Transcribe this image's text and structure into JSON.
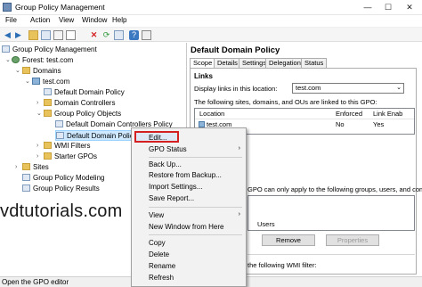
{
  "window": {
    "title": "Group Policy Management",
    "minimize": "—",
    "maximize": "☐",
    "close": "✕"
  },
  "menu": [
    "File",
    "Action",
    "View",
    "Window",
    "Help"
  ],
  "tree": {
    "root": "Group Policy Management",
    "forest": "Forest: test.com",
    "domains": "Domains",
    "domain": "test.com",
    "default_domain_policy": "Default Domain Policy",
    "domain_controllers": "Domain Controllers",
    "gpo_folder": "Group Policy Objects",
    "gpo_ddcp": "Default Domain Controllers Policy",
    "gpo_ddp": "Default Domain Policy",
    "wmi_filters": "WMI Filters",
    "starter_gpos": "Starter GPOs",
    "sites": "Sites",
    "modeling": "Group Policy Modeling",
    "results": "Group Policy Results"
  },
  "right_pane": {
    "title": "Default Domain Policy",
    "tabs": [
      "Scope",
      "Details",
      "Settings",
      "Delegation",
      "Status"
    ],
    "active_tab": "Scope",
    "links_heading": "Links",
    "display_links_label": "Display links in this location:",
    "display_links_value": "test.com",
    "linked_desc": "The following sites, domains, and OUs are linked to this GPO:",
    "columns": [
      "Location",
      "Enforced",
      "Link Enab"
    ],
    "rows": [
      {
        "location": "test.com",
        "enforced": "No",
        "link_enabled": "Yes"
      }
    ],
    "filter_desc": "GPO can only apply to the following groups, users, and comput",
    "filter_item": "Users",
    "remove_button": "Remove",
    "properties_button": "Properties",
    "wmi_desc": "the following WMI filter:"
  },
  "context_menu": {
    "edit": "Edit...",
    "gpo_status": "GPO Status",
    "back_up": "Back Up...",
    "restore": "Restore from Backup...",
    "import": "Import Settings...",
    "save_report": "Save Report...",
    "view": "View",
    "new_window": "New Window from Here",
    "copy": "Copy",
    "delete": "Delete",
    "rename": "Rename",
    "refresh": "Refresh"
  },
  "watermark": "vdtutorials.com",
  "status": "Open the GPO editor",
  "colors": {
    "selection": "#cde8ff",
    "edit_highlight_border": "#d42020"
  }
}
